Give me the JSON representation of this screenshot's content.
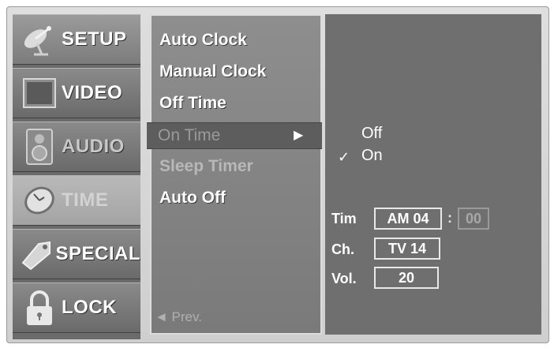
{
  "categories": [
    {
      "label": "SETUP",
      "icon": "satellite-dish-icon"
    },
    {
      "label": "VIDEO",
      "icon": "screen-icon"
    },
    {
      "label": "AUDIO",
      "icon": "speaker-icon"
    },
    {
      "label": "TIME",
      "icon": "clock-icon"
    },
    {
      "label": "SPECIAL",
      "icon": "tag-icon"
    },
    {
      "label": "LOCK",
      "icon": "padlock-icon"
    }
  ],
  "submenu": {
    "items": [
      "Auto Clock",
      "Manual Clock",
      "Off Time",
      "On Time",
      "Sleep Timer",
      "Auto Off"
    ],
    "selected": "On Time",
    "arrow": "▶",
    "prev_label": "◄ Prev."
  },
  "panel": {
    "options": [
      "Off",
      "On"
    ],
    "checked": "On",
    "check_mark": "✓",
    "time_label": "Tim",
    "time_ampm_hour": "AM 04",
    "time_sep": ":",
    "time_minute": "00",
    "ch_label": "Ch.",
    "ch_value": "TV 14",
    "vol_label": "Vol.",
    "vol_value": "20"
  }
}
